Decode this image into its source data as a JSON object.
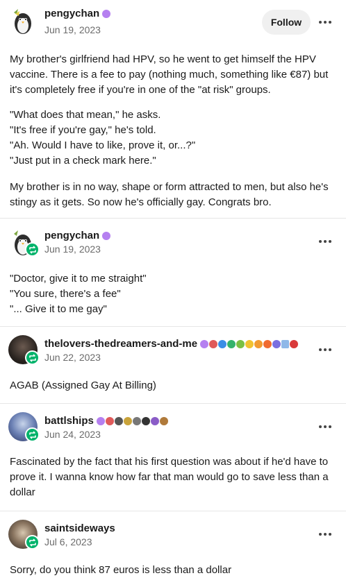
{
  "follow_label": "Follow",
  "colors": {
    "reblog_green": "#00b36b",
    "muted": "#6b6b6b",
    "divider": "#e6e6e6"
  },
  "posts": [
    {
      "username": "pengychan",
      "date": "Jun 19, 2023",
      "avatar": "penguin-avatar",
      "paragraphs": [
        "My brother's girlfriend had HPV, so he went to get himself the HPV",
        "vaccine. There is a fee to pay (nothing much, something like €87) but",
        "it's completely free if you're in one of the \"at risk\" groups.",
        "\"What does that mean,\" he asks.",
        "\"It's free if you're gay,\" he's told.",
        "\"Ah. Would I have to like, prove it, or...?\"",
        "\"Just put in a check mark here.\"",
        "My brother is in no way, shape or form attracted to men, but also he's",
        "stingy as it gets. So now he's officially gay. Congrats bro."
      ]
    },
    {
      "username": "pengychan",
      "date": "Jun 19, 2023",
      "avatar": "penguin-avatar",
      "paragraphs": [
        "\"Doctor, give it to me straight\"",
        "\"You sure, there's a fee\"",
        "\"... Give it to me gay\""
      ]
    },
    {
      "username": "thelovers-thedreamers-and-me",
      "date": "Jun 22, 2023",
      "avatar": "dark-portrait-avatar",
      "paragraphs": [
        "AGAB (Assigned Gay At Billing)"
      ]
    },
    {
      "username": "battlships",
      "date": "Jun 24, 2023",
      "avatar": "anime-character-avatar",
      "paragraphs": [
        "Fascinated by the fact that his first question was about if he'd have to",
        "prove it. I wanna know how far that man would go to save less than a",
        "dollar"
      ]
    },
    {
      "username": "saintsideways",
      "date": "Jul 6, 2023",
      "avatar": "cat-avatar",
      "paragraphs": [
        "Sorry, do you think 87 euros is less than a dollar"
      ]
    }
  ]
}
